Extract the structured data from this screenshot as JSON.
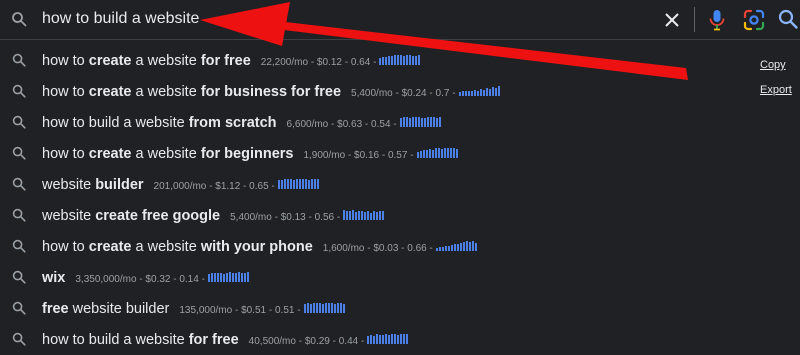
{
  "search": {
    "query": "how to build a website",
    "clear_icon": "close-icon",
    "voice_icon": "mic-icon",
    "lens_icon": "camera-lens-icon",
    "search_icon": "search-icon"
  },
  "side_links": {
    "copy": "Copy",
    "export": "Export"
  },
  "suggestions": [
    {
      "parts": [
        {
          "t": "how to ",
          "b": false
        },
        {
          "t": "create",
          "b": true
        },
        {
          "t": " a website ",
          "b": false
        },
        {
          "t": "for free",
          "b": true
        }
      ],
      "stats": "22,200/mo - $0.12 - 0.64 -",
      "trend": [
        7,
        8,
        8,
        9,
        9,
        10,
        10,
        10,
        9,
        10,
        10,
        9,
        9,
        10
      ]
    },
    {
      "parts": [
        {
          "t": "how to ",
          "b": false
        },
        {
          "t": "create",
          "b": true
        },
        {
          "t": " a website ",
          "b": false
        },
        {
          "t": "for business for free",
          "b": true
        }
      ],
      "stats": "5,400/mo - $0.24 - 0.7 -",
      "trend": [
        4,
        5,
        5,
        6,
        5,
        7,
        6,
        8,
        7,
        9,
        8,
        10,
        9,
        11
      ]
    },
    {
      "parts": [
        {
          "t": "how to build a website ",
          "b": false
        },
        {
          "t": "from scratch",
          "b": true
        }
      ],
      "stats": "6,600/mo - $0.63 - 0.54 -",
      "trend": [
        8,
        9,
        9,
        8,
        9,
        9,
        9,
        8,
        8,
        9,
        9,
        9,
        8,
        9
      ]
    },
    {
      "parts": [
        {
          "t": "how to ",
          "b": false
        },
        {
          "t": "create",
          "b": true
        },
        {
          "t": " a website ",
          "b": false
        },
        {
          "t": "for beginners",
          "b": true
        }
      ],
      "stats": "1,900/mo - $0.16 - 0.57 -",
      "trend": [
        6,
        7,
        8,
        8,
        9,
        8,
        10,
        10,
        9,
        10,
        10,
        10,
        10,
        9
      ]
    },
    {
      "parts": [
        {
          "t": "website ",
          "b": false
        },
        {
          "t": "builder",
          "b": true
        }
      ],
      "stats": "201,000/mo - $1.12 - 0.65 -",
      "trend": [
        7,
        7,
        8,
        8,
        8,
        7,
        8,
        8,
        8,
        8,
        7,
        8,
        8,
        8
      ]
    },
    {
      "parts": [
        {
          "t": "website ",
          "b": false
        },
        {
          "t": "create free google",
          "b": true
        }
      ],
      "stats": "5,400/mo - $0.13 - 0.56 -",
      "trend": [
        10,
        9,
        9,
        10,
        8,
        9,
        9,
        8,
        9,
        7,
        9,
        8,
        9,
        9
      ]
    },
    {
      "parts": [
        {
          "t": "how to ",
          "b": false
        },
        {
          "t": "create",
          "b": true
        },
        {
          "t": " a website ",
          "b": false
        },
        {
          "t": "with your phone",
          "b": true
        }
      ],
      "stats": "1,600/mo - $0.03 - 0.66 -",
      "trend": [
        3,
        4,
        4,
        5,
        5,
        6,
        7,
        7,
        8,
        9,
        10,
        9,
        10,
        8
      ]
    },
    {
      "parts": [
        {
          "t": "wix",
          "b": true
        }
      ],
      "stats": "3,350,000/mo - $0.32 - 0.14 -",
      "trend": [
        8,
        9,
        9,
        9,
        9,
        8,
        9,
        10,
        9,
        9,
        10,
        9,
        9,
        10
      ]
    },
    {
      "parts": [
        {
          "t": "free",
          "b": true
        },
        {
          "t": " website builder",
          "b": false
        }
      ],
      "stats": "135,000/mo - $0.51 - 0.51 -",
      "trend": [
        8,
        9,
        8,
        9,
        9,
        9,
        8,
        9,
        9,
        9,
        8,
        9,
        9,
        8
      ]
    },
    {
      "parts": [
        {
          "t": "how to build a website ",
          "b": false
        },
        {
          "t": "for free",
          "b": true
        }
      ],
      "stats": "40,500/mo - $0.29 - 0.44 -",
      "trend": [
        6,
        7,
        6,
        8,
        7,
        7,
        8,
        7,
        8,
        8,
        7,
        8,
        8,
        8
      ]
    }
  ],
  "colors": {
    "background": "#202124",
    "text": "#e8eaed",
    "muted": "#9aa0a6",
    "trend_bar": "#4a80e8",
    "arrow": "#ee1111"
  }
}
